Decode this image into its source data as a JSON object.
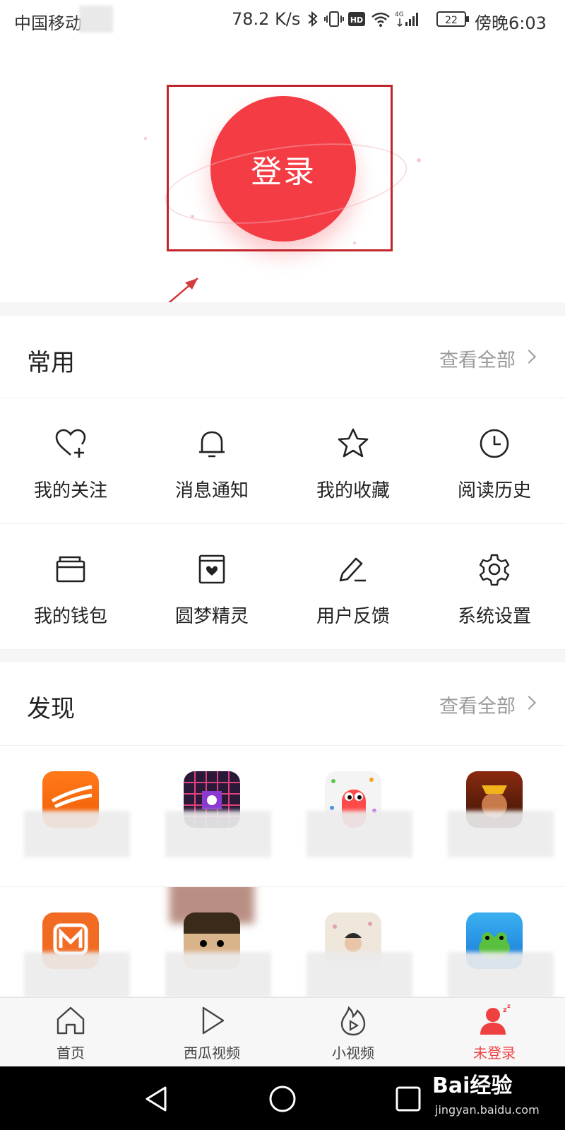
{
  "status_bar": {
    "carrier": "中国移动",
    "speed": "78.2 K/s",
    "battery": "22",
    "time": "傍晚6:03",
    "icons": [
      "bluetooth-icon",
      "vibrate-icon",
      "hd-icon",
      "wifi-icon",
      "4g-signal-icon",
      "battery-icon"
    ]
  },
  "hero": {
    "login_label": "登录",
    "accent_color": "#f43c45",
    "highlight_color": "#c0252c"
  },
  "common": {
    "title": "常用",
    "more": "查看全部",
    "items": [
      {
        "label": "我的关注",
        "icon": "heart-plus-icon"
      },
      {
        "label": "消息通知",
        "icon": "bell-icon"
      },
      {
        "label": "我的收藏",
        "icon": "star-icon"
      },
      {
        "label": "阅读历史",
        "icon": "clock-icon"
      },
      {
        "label": "我的钱包",
        "icon": "wallet-icon"
      },
      {
        "label": "圆梦精灵",
        "icon": "heart-box-icon"
      },
      {
        "label": "用户反馈",
        "icon": "pencil-icon"
      },
      {
        "label": "系统设置",
        "icon": "gear-icon"
      }
    ]
  },
  "discover": {
    "title": "发现",
    "more": "查看全部"
  },
  "tab_bar": {
    "tabs": [
      {
        "label": "首页",
        "icon": "home-icon"
      },
      {
        "label": "西瓜视频",
        "icon": "play-icon"
      },
      {
        "label": "小视频",
        "icon": "flame-play-icon"
      },
      {
        "label": "未登录",
        "icon": "user-icon"
      }
    ],
    "active_color": "#f04142"
  },
  "watermark": {
    "brand": "Bai经验",
    "url": "jingyan.baidu.com"
  }
}
